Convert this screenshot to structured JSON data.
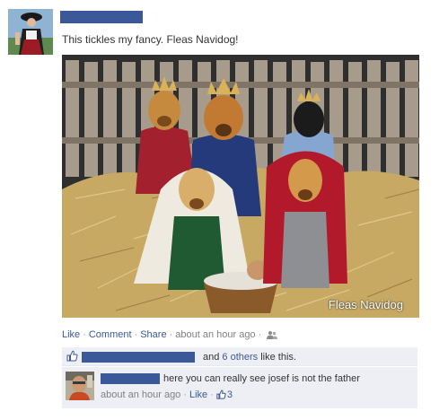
{
  "post": {
    "message": "This tickles my fancy. Fleas Navidog!",
    "photo_watermark": "Fleas Navidog",
    "actions": {
      "like": "Like",
      "comment": "Comment",
      "share": "Share",
      "timestamp": "about an hour ago",
      "separator": "·",
      "audience_icon": "friends-icon"
    },
    "likes": {
      "icon": "thumbs-up-icon",
      "and_text": "and",
      "others_link": "6 others",
      "suffix": "like this."
    },
    "comment": {
      "text": "here you can really see josef is not the father",
      "timestamp": "about an hour ago",
      "like_label": "Like",
      "like_count": "3",
      "like_icon": "thumbs-up-icon"
    }
  },
  "colors": {
    "name_redaction": "#3b5998",
    "link": "#3b5998",
    "feedback_background": "#edeff4",
    "meta_text": "#808080"
  }
}
